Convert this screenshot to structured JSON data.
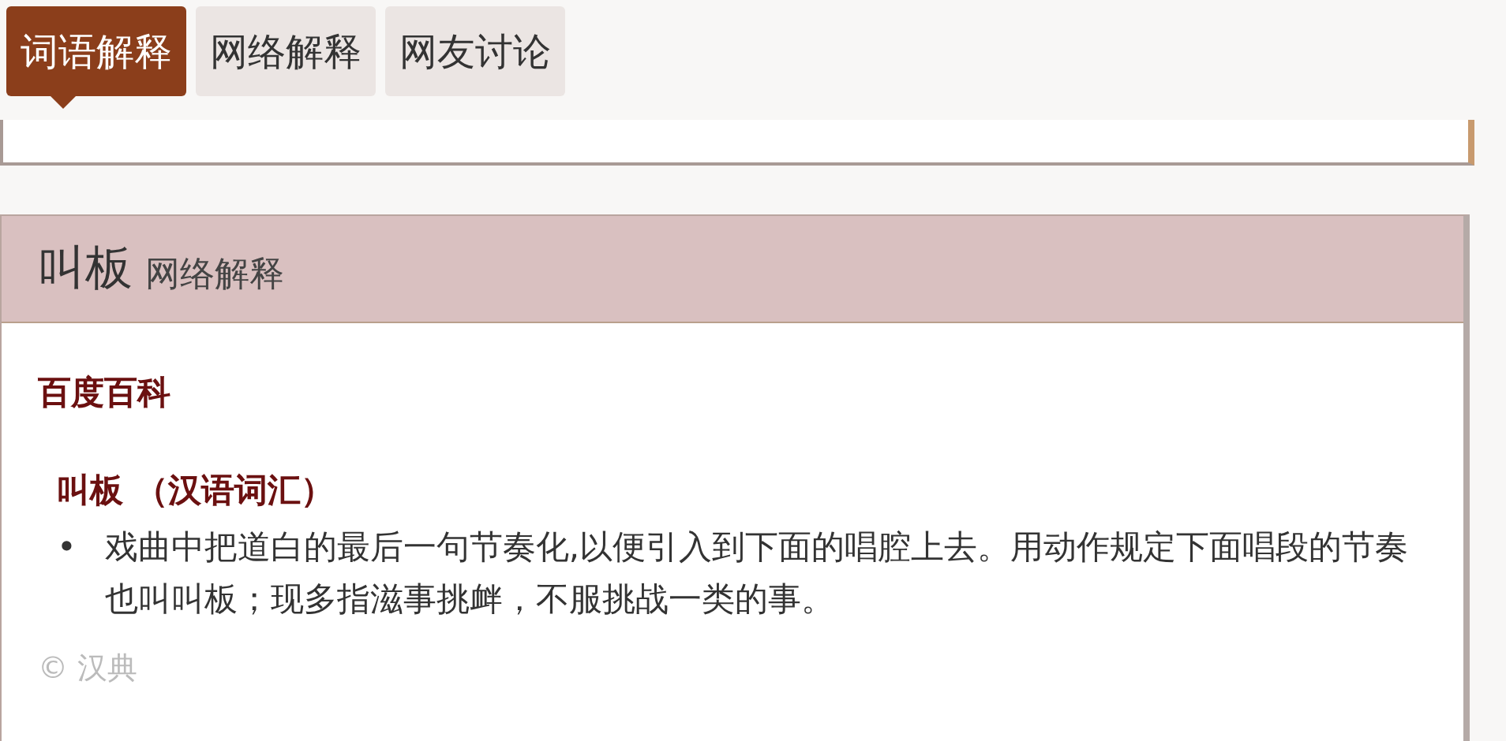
{
  "tabs": [
    {
      "label": "词语解释",
      "selected": true
    },
    {
      "label": "网络解释",
      "selected": false
    },
    {
      "label": "网友讨论",
      "selected": false
    }
  ],
  "card": {
    "title": "叫板",
    "subtitle": "网络解释",
    "source": "百度百科",
    "entry_title": "叫板 （汉语词汇）",
    "bullet": "•",
    "definition": "戏曲中把道白的最后一句节奏化,以便引入到下面的唱腔上去。用动作规定下面唱段的节奏也叫叫板；现多指滋事挑衅，不服挑战一类的事。",
    "copyright": "© 汉典"
  }
}
